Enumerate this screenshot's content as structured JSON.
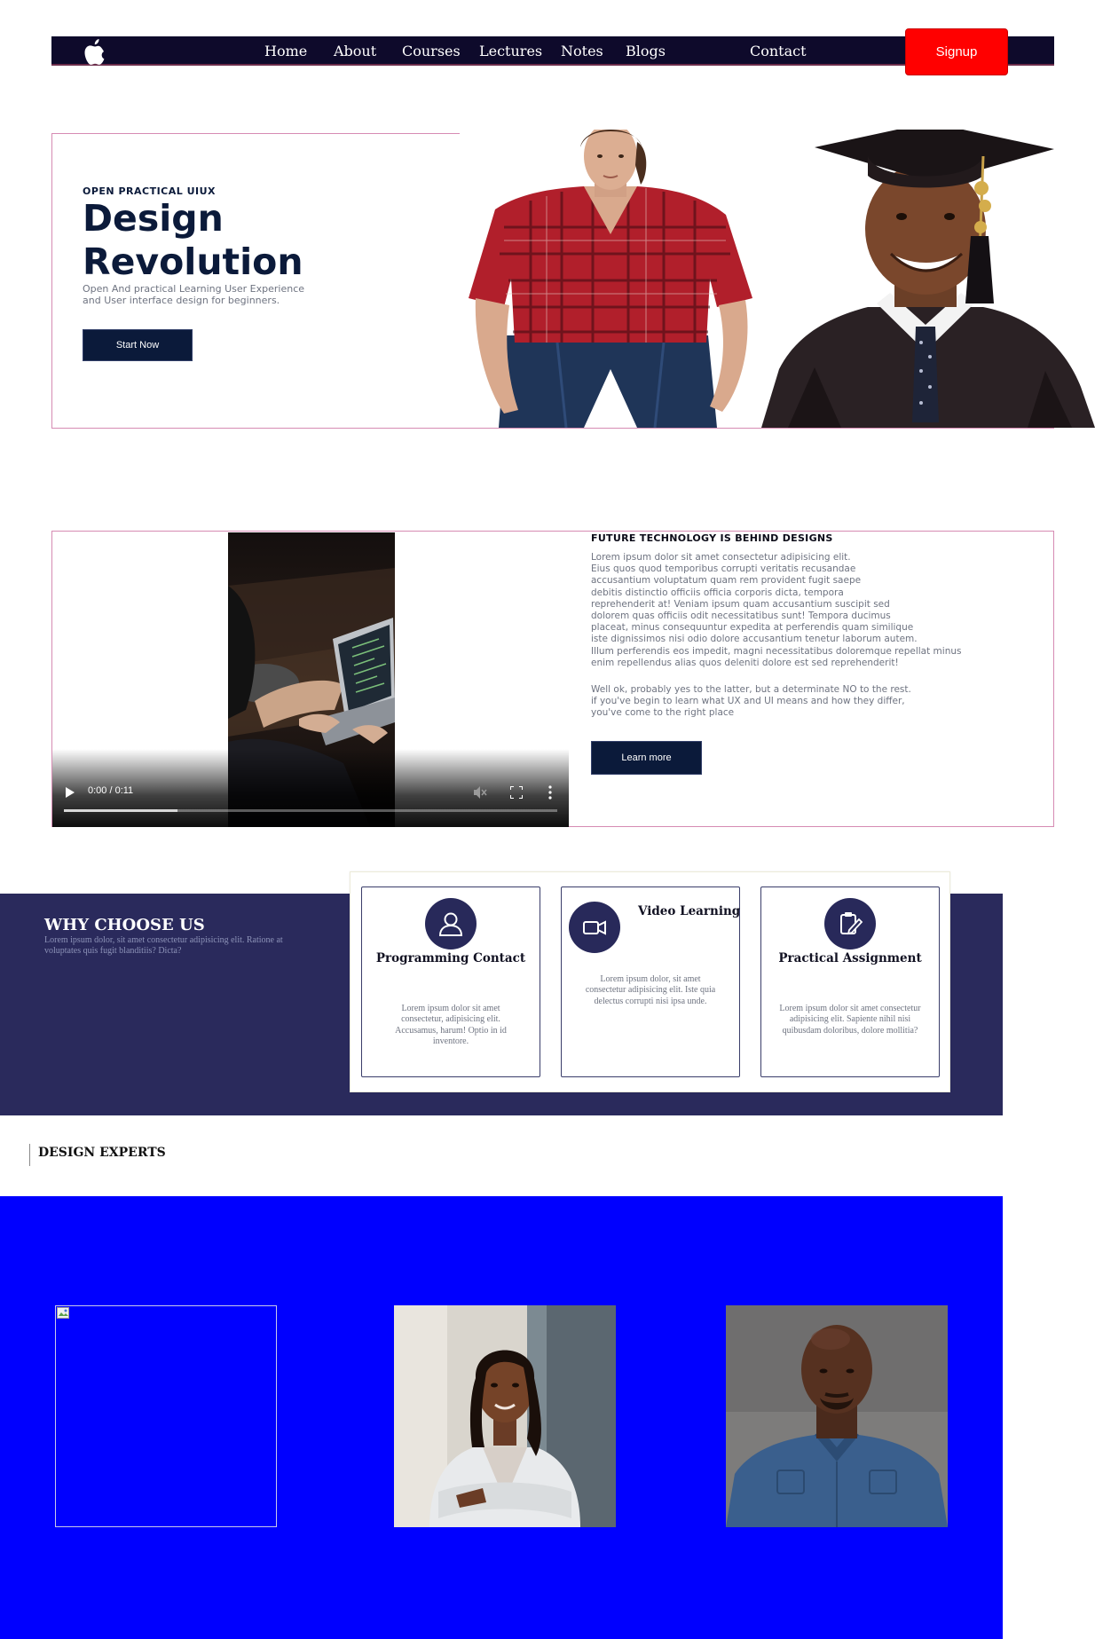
{
  "nav": {
    "logo_icon": "apple-logo-icon",
    "links": [
      "Home",
      "About",
      "Courses",
      "Lectures",
      "Notes",
      "Blogs",
      "Contact"
    ],
    "signup_label": "Signup",
    "colors": {
      "bar": "#0e0a2b",
      "signup": "#ff0000"
    }
  },
  "hero": {
    "eyebrow": "OPEN PRACTICAL UIUX",
    "title_line1": "Design",
    "title_line2": "Revolution",
    "subtitle": "Open And practical Learning User Experience and User interface design for beginners.",
    "button_label": "Start Now"
  },
  "video_section": {
    "player": {
      "time": "0:00 / 0:11",
      "progress": 0.23,
      "icons": [
        "play-icon",
        "volume-muted-icon",
        "fullscreen-icon",
        "more-options-icon"
      ]
    },
    "title": "FUTURE TECHNOLOGY IS BEHIND DESIGNS",
    "paragraph1_lines": [
      "Lorem ipsum dolor sit amet consectetur adipisicing elit.",
      "Eius quos quod temporibus corrupti veritatis recusandae",
      "accusantium voluptatum quam rem provident fugit saepe",
      "debitis distinctio officiis officia corporis dicta, tempora",
      "reprehenderit at! Veniam ipsum quam accusantium suscipit sed",
      "dolorem quas officiis odit necessitatibus sunt! Tempora ducimus",
      "placeat, minus consequuntur expedita at perferendis quam similique",
      "iste dignissimos nisi odio dolore accusantium tenetur laborum autem.",
      "Illum perferendis eos impedit, magni necessitatibus doloremque repellat minus",
      "enim repellendus alias quos deleniti dolore est sed reprehenderit!"
    ],
    "paragraph2_lines": [
      "Well ok, probably yes to the latter, but a determinate NO to the rest.",
      "if you've begin to learn what UX and UI means and how they differ,",
      "you've come to the right place"
    ],
    "button_label": "Learn more"
  },
  "why": {
    "title": "WHY CHOOSE US",
    "subtitle": "Lorem ipsum dolor, sit amet consectetur adipisicing elit. Ratione at voluptates quis fugit blanditiis? Dicta?",
    "cards": [
      {
        "title": "Programming Contact",
        "icon": "user-icon",
        "desc": "Lorem ipsum dolor sit amet consectetur, adipisicing elit. Accusamus, harum! Optio in id inventore."
      },
      {
        "title": "Video Learning",
        "icon": "video-camera-icon",
        "desc": "Lorem ipsum dolor, sit amet consectetur adipisicing elit. Iste quia delectus corrupti nisi ipsa unde."
      },
      {
        "title": "Practical Assignment",
        "icon": "clipboard-edit-icon",
        "desc": "Lorem ipsum dolor sit amet consectetur adipisicing elit. Sapiente nihil nisi quibusdam doloribus, dolore mollitia?"
      }
    ]
  },
  "experts": {
    "title": "DESIGN EXPERTS",
    "band_color": "#0000ff",
    "photos": [
      "broken-image-icon",
      "expert-woman-photo",
      "expert-man-photo"
    ]
  }
}
